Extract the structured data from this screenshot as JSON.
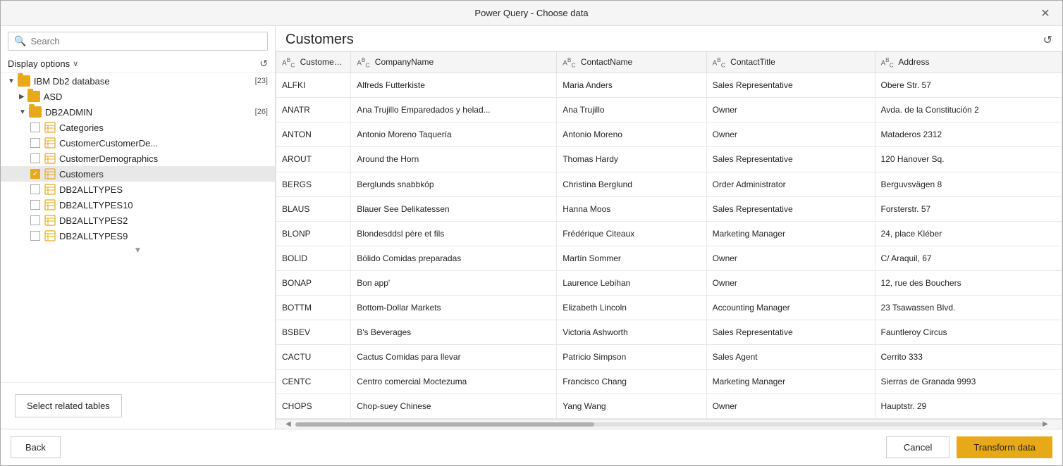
{
  "window": {
    "title": "Power Query - Choose data",
    "close_label": "✕"
  },
  "left_panel": {
    "search_placeholder": "Search",
    "display_options_label": "Display options",
    "chevron_down": "∨",
    "refresh_icon": "↺",
    "tree": [
      {
        "id": "ibm-db2",
        "label": "IBM Db2 database",
        "type": "folder",
        "expanded": true,
        "badge": "[23]",
        "indent": 1,
        "has_chevron": true,
        "chevron_dir": "down"
      },
      {
        "id": "asd",
        "label": "ASD",
        "type": "folder",
        "expanded": false,
        "badge": "",
        "indent": 2,
        "has_chevron": true,
        "chevron_dir": "right"
      },
      {
        "id": "db2admin",
        "label": "DB2ADMIN",
        "type": "folder",
        "expanded": true,
        "badge": "[26]",
        "indent": 2,
        "has_chevron": true,
        "chevron_dir": "down"
      },
      {
        "id": "categories",
        "label": "Categories",
        "type": "table",
        "checked": false,
        "indent": 3
      },
      {
        "id": "customercustomerde",
        "label": "CustomerCustomerDe...",
        "type": "table",
        "checked": false,
        "indent": 3
      },
      {
        "id": "customerdemographics",
        "label": "CustomerDemographics",
        "type": "table",
        "checked": false,
        "indent": 3
      },
      {
        "id": "customers",
        "label": "Customers",
        "type": "table",
        "checked": true,
        "indent": 3,
        "selected": true
      },
      {
        "id": "db2alltypes",
        "label": "DB2ALLTYPES",
        "type": "table",
        "checked": false,
        "indent": 3
      },
      {
        "id": "db2alltypes10",
        "label": "DB2ALLTYPES10",
        "type": "table",
        "checked": false,
        "indent": 3
      },
      {
        "id": "db2alltypes2",
        "label": "DB2ALLTYPES2",
        "type": "table",
        "checked": false,
        "indent": 3
      },
      {
        "id": "db2alltypes9",
        "label": "DB2ALLTYPES9",
        "type": "table",
        "checked": false,
        "indent": 3
      }
    ],
    "select_related_btn": "Select related tables"
  },
  "right_panel": {
    "table_title": "Customers",
    "refresh_icon": "↺",
    "columns": [
      {
        "id": "customerid",
        "label": "CustomerID",
        "type_icon": "ABC"
      },
      {
        "id": "companyname",
        "label": "CompanyName",
        "type_icon": "ABC"
      },
      {
        "id": "contactname",
        "label": "ContactName",
        "type_icon": "ABC"
      },
      {
        "id": "contacttitle",
        "label": "ContactTitle",
        "type_icon": "ABC"
      },
      {
        "id": "address",
        "label": "Address",
        "type_icon": "ABC"
      }
    ],
    "rows": [
      [
        "ALFKI",
        "Alfreds Futterkiste",
        "Maria Anders",
        "Sales Representative",
        "Obere Str. 57"
      ],
      [
        "ANATR",
        "Ana Trujillo Emparedados y helad...",
        "Ana Trujillo",
        "Owner",
        "Avda. de la Constitución 2"
      ],
      [
        "ANTON",
        "Antonio Moreno Taquería",
        "Antonio Moreno",
        "Owner",
        "Mataderos 2312"
      ],
      [
        "AROUT",
        "Around the Horn",
        "Thomas Hardy",
        "Sales Representative",
        "120 Hanover Sq."
      ],
      [
        "BERGS",
        "Berglunds snabbköp",
        "Christina Berglund",
        "Order Administrator",
        "Berguvsvägen 8"
      ],
      [
        "BLAUS",
        "Blauer See Delikatessen",
        "Hanna Moos",
        "Sales Representative",
        "Forsterstr. 57"
      ],
      [
        "BLONP",
        "Blondesddsl père et fils",
        "Frédérique Citeaux",
        "Marketing Manager",
        "24, place Kléber"
      ],
      [
        "BOLID",
        "Bólido Comidas preparadas",
        "Martín Sommer",
        "Owner",
        "C/ Araquil, 67"
      ],
      [
        "BONAP",
        "Bon app'",
        "Laurence Lebihan",
        "Owner",
        "12, rue des Bouchers"
      ],
      [
        "BOTTM",
        "Bottom-Dollar Markets",
        "Elizabeth Lincoln",
        "Accounting Manager",
        "23 Tsawassen Blvd."
      ],
      [
        "BSBEV",
        "B's Beverages",
        "Victoria Ashworth",
        "Sales Representative",
        "Fauntleroy Circus"
      ],
      [
        "CACTU",
        "Cactus Comidas para llevar",
        "Patricio Simpson",
        "Sales Agent",
        "Cerrito 333"
      ],
      [
        "CENTC",
        "Centro comercial Moctezuma",
        "Francisco Chang",
        "Marketing Manager",
        "Sierras de Granada 9993"
      ],
      [
        "CHOPS",
        "Chop-suey Chinese",
        "Yang Wang",
        "Owner",
        "Hauptstr. 29"
      ]
    ]
  },
  "bottom_bar": {
    "back_label": "Back",
    "cancel_label": "Cancel",
    "transform_label": "Transform data"
  }
}
